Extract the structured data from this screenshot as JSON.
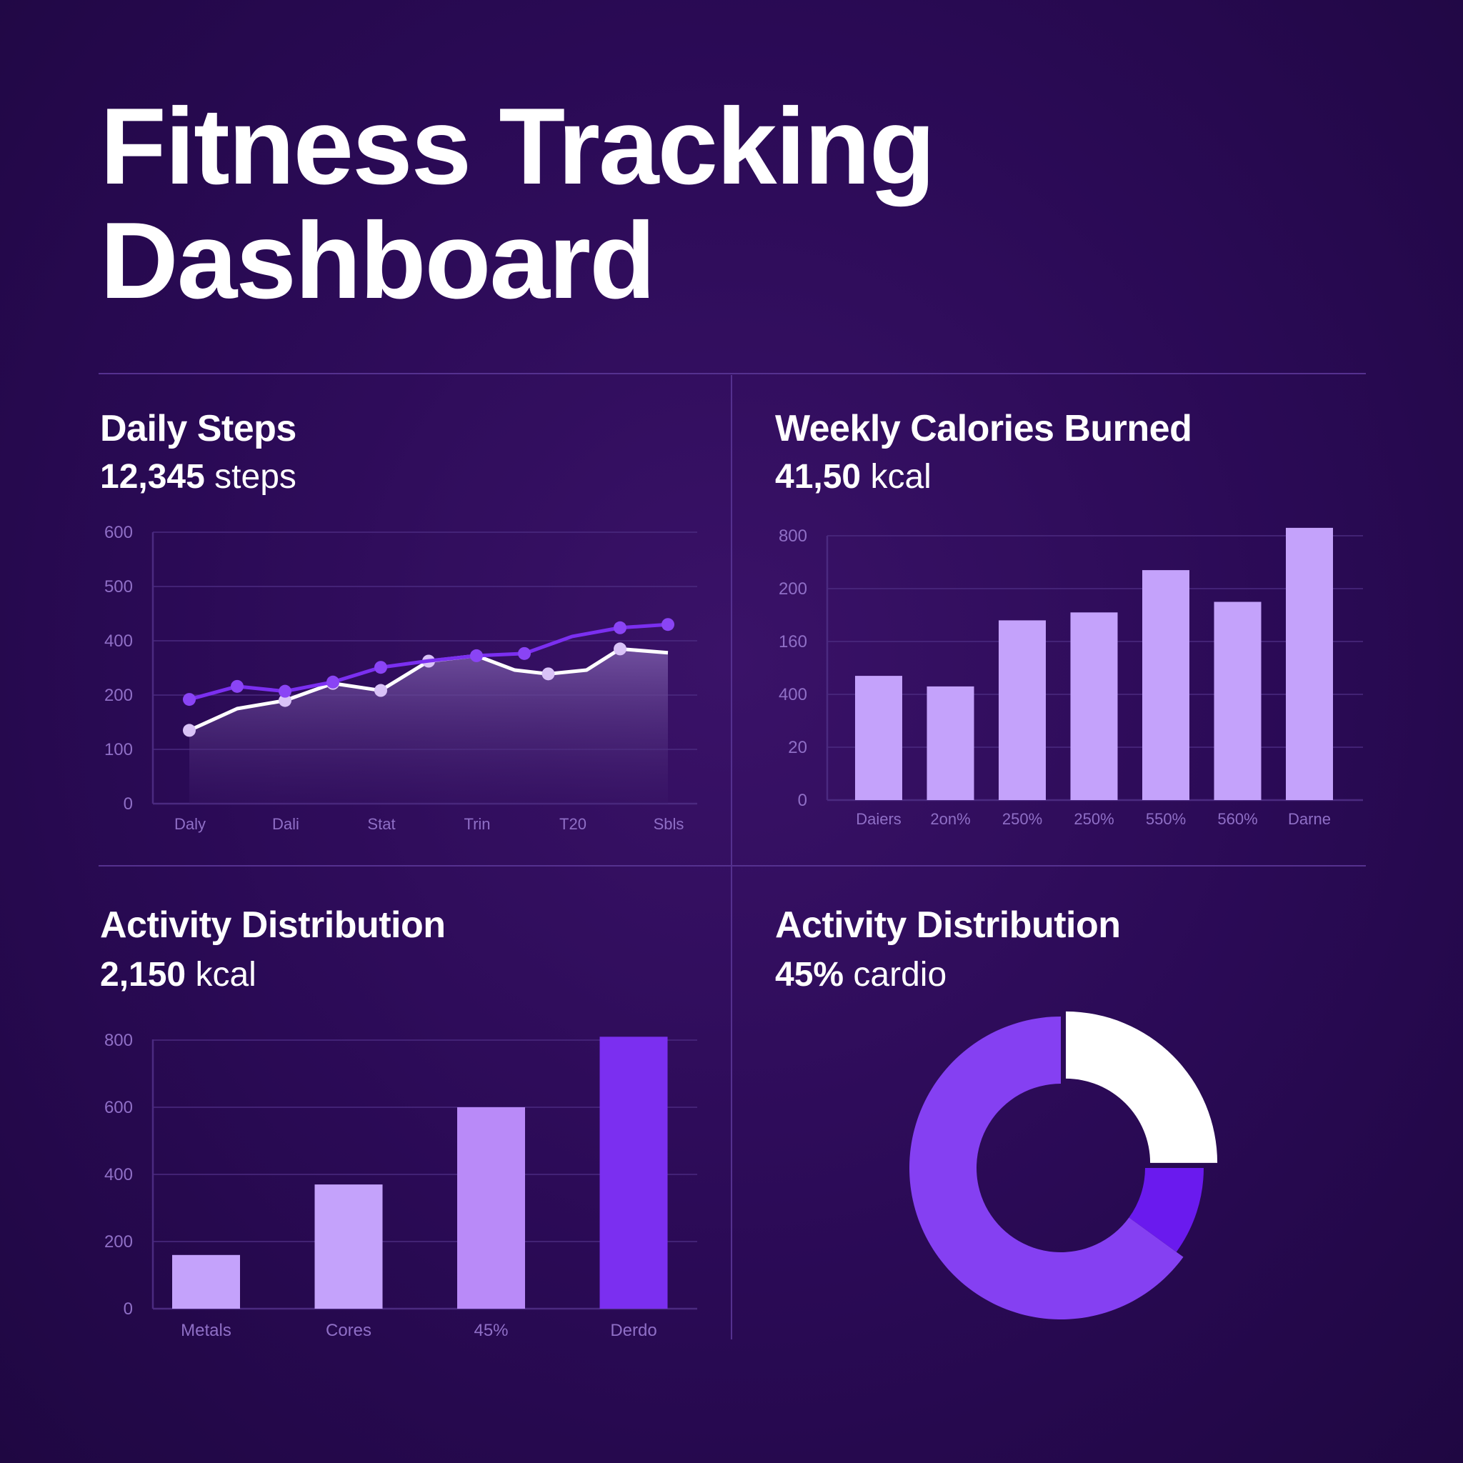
{
  "page": {
    "title_line1": "Fitness Tracking",
    "title_line2": "Dashboard"
  },
  "colors": {
    "background": "#2a0a55",
    "accent_purple": "#7b2ff0",
    "light_purple": "#c4a2fb",
    "white": "#ffffff",
    "grid": "#4b2a80",
    "tick_text": "#8f6fc6"
  },
  "panels": {
    "steps": {
      "title": "Daily Steps",
      "metric_value": "12,345",
      "metric_unit": "steps"
    },
    "calories": {
      "title": "Weekly Calories Burned",
      "metric_value": "41,50",
      "metric_unit": "kcal"
    },
    "activity_bars": {
      "title": "Activity Distribution",
      "metric_value": "2,150",
      "metric_unit": "kcal"
    },
    "activity_donut": {
      "title": "Activity Distribution",
      "metric_value": "45%",
      "metric_unit": "cardio"
    }
  },
  "chart_data": [
    {
      "id": "steps",
      "type": "line",
      "y_tick_labels": [
        "0",
        "100",
        "200",
        "400",
        "500",
        "600"
      ],
      "x_tick_labels": [
        "Daly",
        "Dali",
        "Stat",
        "Trin",
        "T20",
        "Sbls"
      ],
      "x": [
        0,
        1,
        2,
        3,
        4,
        5,
        6,
        7,
        8,
        9,
        10
      ],
      "series": [
        {
          "color": "#7b2ff0",
          "values": [
            192,
            232,
            214,
            248,
            302,
            326,
            345,
            353,
            408,
            424,
            430
          ],
          "markers": [
            0,
            1,
            2,
            3,
            4,
            6,
            7,
            9,
            10
          ]
        },
        {
          "color": "#ffffff",
          "values": [
            135,
            175,
            190,
            243,
            217,
            325,
            345,
            292,
            278,
            292,
            370,
            356
          ],
          "markers": [
            0,
            2,
            3,
            4,
            5,
            8,
            10
          ],
          "x": [
            0,
            1,
            2,
            3,
            4,
            5,
            6,
            6.8,
            7.5,
            8.3,
            9,
            10
          ],
          "area": true
        }
      ],
      "grid": true
    },
    {
      "id": "calories",
      "type": "bar",
      "y_tick_labels": [
        "0",
        "20",
        "400",
        "160",
        "200",
        "800"
      ],
      "categories": [
        "Daiers",
        "2on%",
        "250%",
        "250%",
        "550%",
        "560%",
        "Darne"
      ],
      "values": [
        0.47,
        0.43,
        0.68,
        0.71,
        0.87,
        0.75,
        1.03
      ],
      "bar_color": "#c4a2fb",
      "grid": true
    },
    {
      "id": "activity_bars",
      "type": "bar",
      "y_tick_labels": [
        "0",
        "200",
        "400",
        "600",
        "800"
      ],
      "y_ticks": [
        0,
        200,
        400,
        600,
        800
      ],
      "categories": [
        "Metals",
        "Cores",
        "45%",
        "Derdo"
      ],
      "values": [
        160,
        370,
        600,
        810
      ],
      "bar_colors": [
        "#c4a2fb",
        "#c4a2fb",
        "#b98af8",
        "#7b2ff0"
      ],
      "ylim": [
        0,
        800
      ],
      "grid": true
    },
    {
      "id": "activity_donut",
      "type": "pie",
      "slices": [
        {
          "value": 25,
          "color": "#ffffff"
        },
        {
          "value": 10,
          "color": "#6a1aee"
        },
        {
          "value": 65,
          "color": "#8540f2"
        }
      ]
    }
  ]
}
